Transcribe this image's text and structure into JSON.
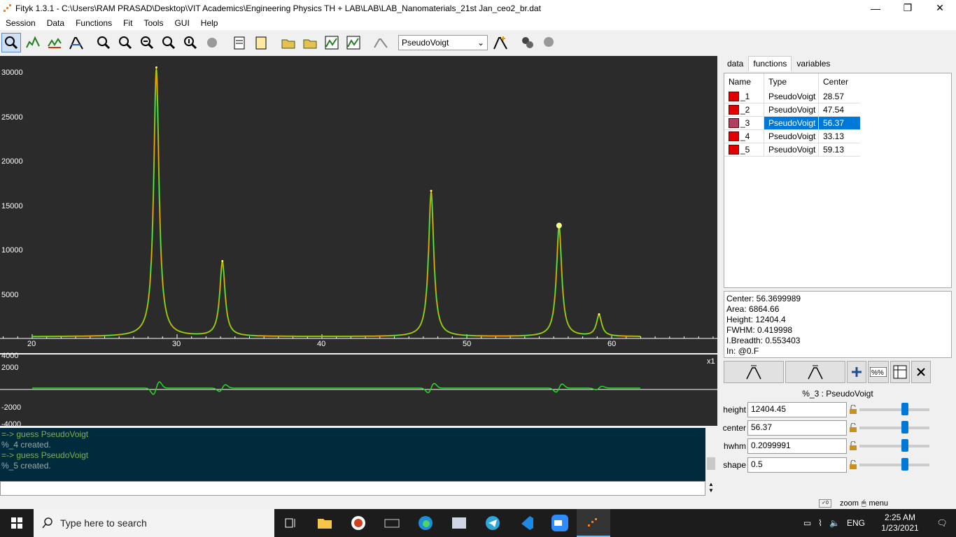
{
  "window": {
    "title": "Fityk 1.3.1 - C:\\Users\\RAM PRASAD\\Desktop\\VIT Academics\\Engineering Physics TH + LAB\\LAB\\LAB_Nanomaterials_21st Jan_ceo2_br.dat",
    "minimize": "—",
    "maximize": "❐",
    "close": "✕"
  },
  "menu": [
    "Session",
    "Data",
    "Functions",
    "Fit",
    "Tools",
    "GUI",
    "Help"
  ],
  "toolbar": {
    "function_select": "PseudoVoigt",
    "dropdown_arrow": "⌄"
  },
  "plot": {
    "y_ticks": [
      "30000",
      "25000",
      "20000",
      "15000",
      "10000",
      "5000"
    ],
    "x_ticks": [
      "20",
      "30",
      "40",
      "50",
      "60"
    ],
    "resid_ticks": [
      "4000",
      "2000",
      "-2000",
      "-4000"
    ],
    "resid_scale": "x1",
    "colors": {
      "background": "#2b2b2b",
      "data": "#22dd22",
      "model": "#ffaa00",
      "points": "#ffff66"
    }
  },
  "chart_data": {
    "type": "line",
    "xlabel": "",
    "ylabel": "",
    "xlim": [
      18,
      70
    ],
    "ylim": [
      0,
      31000
    ],
    "peaks": [
      {
        "center": 28.57,
        "height": 30200
      },
      {
        "center": 33.13,
        "height": 8400
      },
      {
        "center": 47.54,
        "height": 16300
      },
      {
        "center": 56.37,
        "height": 12400
      },
      {
        "center": 59.13,
        "height": 2400
      }
    ],
    "x_range_data": [
      20,
      62
    ]
  },
  "console": {
    "lines": [
      {
        "type": "cmd",
        "text": "=-> guess PseudoVoigt"
      },
      {
        "type": "out",
        "text": "%_4 created."
      },
      {
        "type": "cmd",
        "text": "=-> guess PseudoVoigt"
      },
      {
        "type": "out",
        "text": "%_5 created."
      }
    ],
    "input_value": ""
  },
  "tabs": [
    "data",
    "functions",
    "variables"
  ],
  "functions_table": {
    "headers": [
      "Name",
      "Type",
      "Center"
    ],
    "rows": [
      {
        "name": "_1",
        "type": "PseudoVoigt",
        "center": "28.57"
      },
      {
        "name": "_2",
        "type": "PseudoVoigt",
        "center": "47.54"
      },
      {
        "name": "_3",
        "type": "PseudoVoigt",
        "center": "56.37"
      },
      {
        "name": "_4",
        "type": "PseudoVoigt",
        "center": "33.13"
      },
      {
        "name": "_5",
        "type": "PseudoVoigt",
        "center": "59.13"
      }
    ],
    "selected_index": 2
  },
  "info": [
    "Center: 56.3699989",
    "Area: 6864.66",
    "Height: 12404.4",
    "FWHM: 0.419998",
    "I.Breadth: 0.553403",
    "In: @0.F"
  ],
  "editor": {
    "function_label": "%_3 : PseudoVoigt",
    "params": [
      {
        "name": "height",
        "value": "12404.45"
      },
      {
        "name": "center",
        "value": "56.37"
      },
      {
        "name": "hwhm",
        "value": "0.2099991"
      },
      {
        "name": "shape",
        "value": "0.5"
      }
    ]
  },
  "status": {
    "text": "zoom",
    "menu": "menu"
  },
  "taskbar": {
    "search_placeholder": "Type here to search",
    "lang": "ENG",
    "time": "2:25 AM",
    "date": "1/23/2021"
  }
}
